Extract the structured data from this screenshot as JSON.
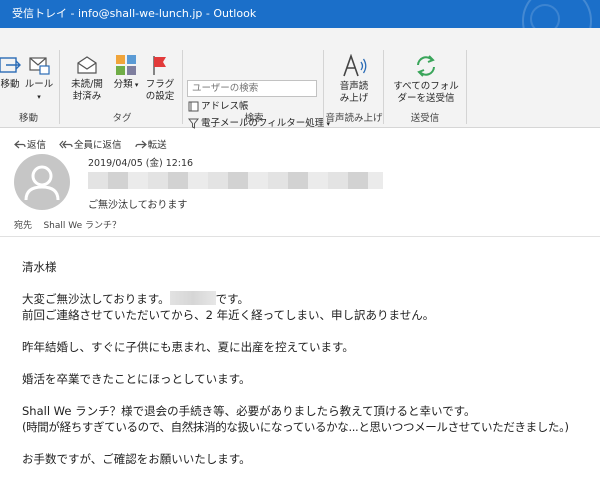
{
  "window": {
    "title": "受信トレイ - info@shall-we-lunch.jp - Outlook"
  },
  "ribbon": {
    "move": {
      "move_label": "移動",
      "rules_label": "ルール",
      "group_label": "移動"
    },
    "tags": {
      "unread_label": "未読/開封済み",
      "categorize_label": "分類",
      "flag_label": "フラグの設定",
      "group_label": "タグ"
    },
    "find": {
      "search_placeholder": "ユーザーの検索",
      "address_book": "アドレス帳",
      "filter_email": "電子メールのフィルター処理",
      "group_label": "検索"
    },
    "speech": {
      "read_aloud_label": "音声読み上げ",
      "group_label": "音声読み上げ"
    },
    "send_receive": {
      "send_all_label": "すべてのフォルダーを送受信",
      "group_label": "送受信"
    }
  },
  "message": {
    "actions": {
      "reply": "返信",
      "reply_all": "全員に返信",
      "forward": "転送"
    },
    "date": "2019/04/05 (金) 12:16",
    "subject": "ご無沙汰しております",
    "to_label": "宛先",
    "to_value": "Shall We ランチ？",
    "body": {
      "greeting": "清水様",
      "line1_a": "大変ご無沙汰しております。",
      "line1_b": "です。",
      "line2": "前回ご連絡させていただいてから、2 年近く経ってしまい、申し訳ありません。",
      "line3": "昨年結婚し、すぐに子供にも恵まれ、夏に出産を控えています。",
      "line4": "婚活を卒業できたことにほっとしています。",
      "line5": "Shall We ランチ？様で退会の手続き等、必要がありましたら教えて頂けると幸いです。",
      "line6": "(時間が経ちすぎているので、自然抹消的な扱いになっているかな...と思いつつメールさせていただきました。)",
      "line7": "お手数ですが、ご確認をお願いいたします。"
    }
  },
  "colors": {
    "titlebar": "#1b6fc9",
    "ribbon": "#f3f3f3",
    "accent_blue": "#2b6cb6",
    "send_green": "#3aa55a"
  }
}
